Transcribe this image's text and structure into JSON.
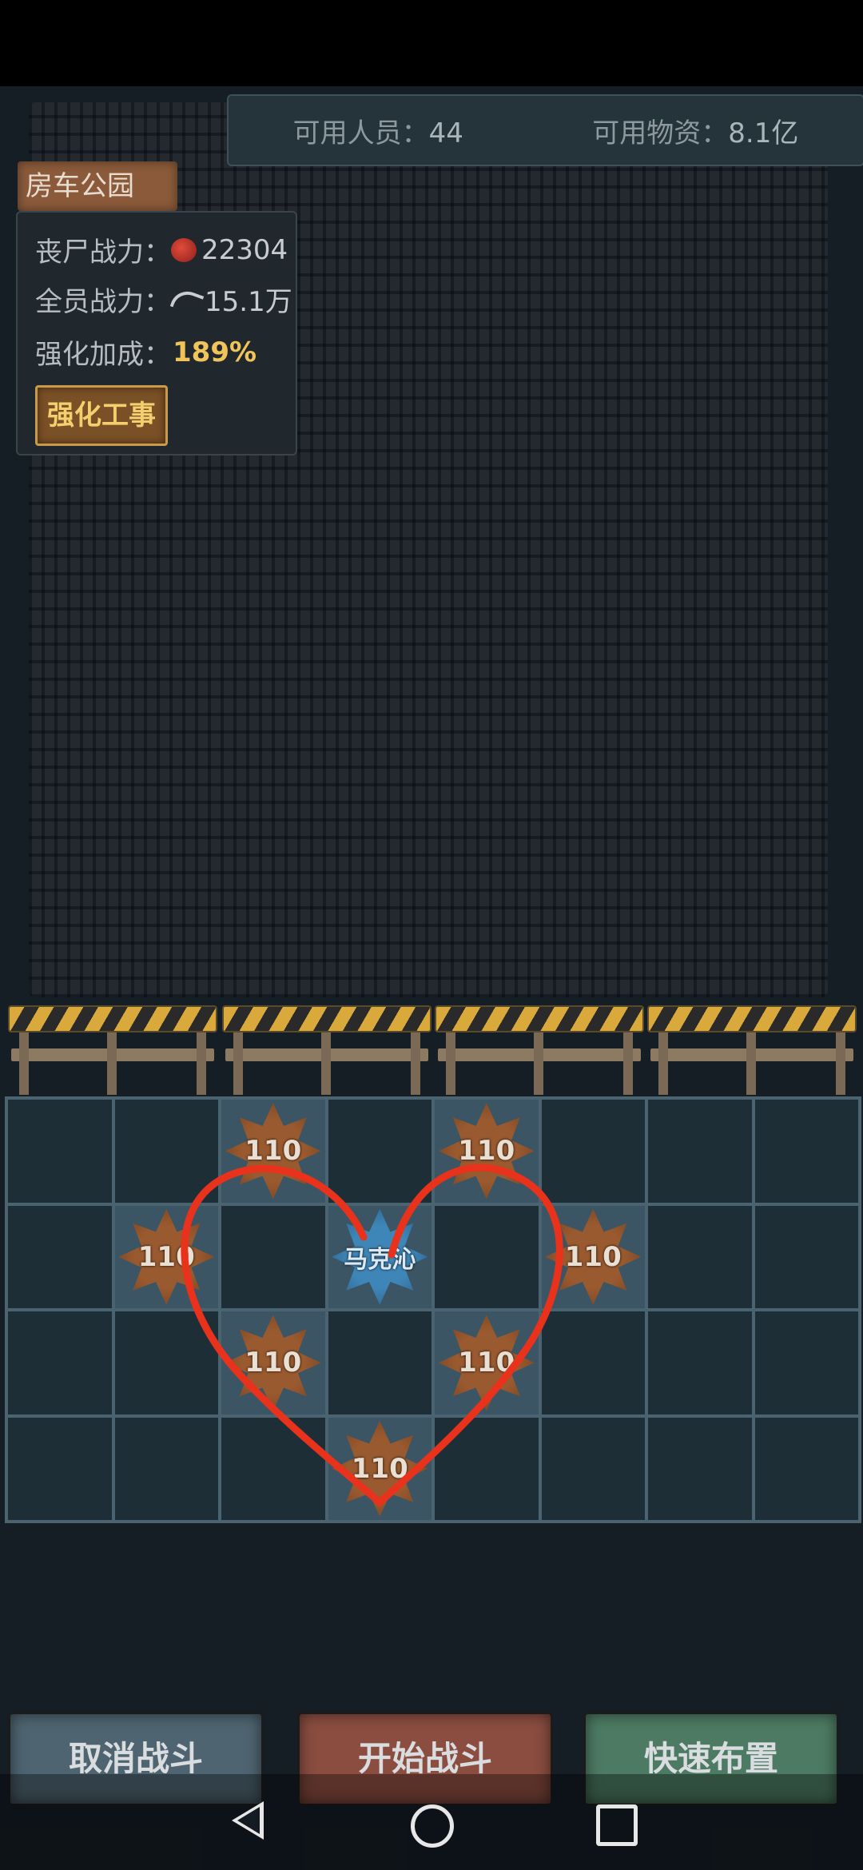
{
  "resources": {
    "personnel_label": "可用人员：",
    "personnel_value": "44",
    "supplies_label": "可用物资：",
    "supplies_value": "8.1亿"
  },
  "location": {
    "name": "房车公园"
  },
  "stats": {
    "zombie_label": "丧尸战力：",
    "zombie_value": "22304",
    "zombie_icon": "zombie-icon",
    "team_label": "全员战力：",
    "team_value": "15.1万",
    "team_icon": "gun-icon",
    "boost_label": "强化加成：",
    "boost_value": "189%",
    "fortify_button": "强化工事"
  },
  "grid": {
    "rows": 4,
    "cols": 8,
    "units": [
      {
        "row": 0,
        "col": 2,
        "type": "enemy",
        "label": "110"
      },
      {
        "row": 0,
        "col": 4,
        "type": "enemy",
        "label": "110"
      },
      {
        "row": 1,
        "col": 1,
        "type": "enemy",
        "label": "110"
      },
      {
        "row": 1,
        "col": 3,
        "type": "hero",
        "label": "马克沁"
      },
      {
        "row": 1,
        "col": 5,
        "type": "enemy",
        "label": "110"
      },
      {
        "row": 2,
        "col": 2,
        "type": "enemy",
        "label": "110"
      },
      {
        "row": 2,
        "col": 4,
        "type": "enemy",
        "label": "110"
      },
      {
        "row": 3,
        "col": 3,
        "type": "enemy",
        "label": "110"
      }
    ]
  },
  "actions": {
    "cancel": "取消战斗",
    "start": "开始战斗",
    "quick": "快速布置"
  },
  "colors": {
    "heart_stroke": "#e8321c",
    "gold_text": "#f1c45a"
  }
}
